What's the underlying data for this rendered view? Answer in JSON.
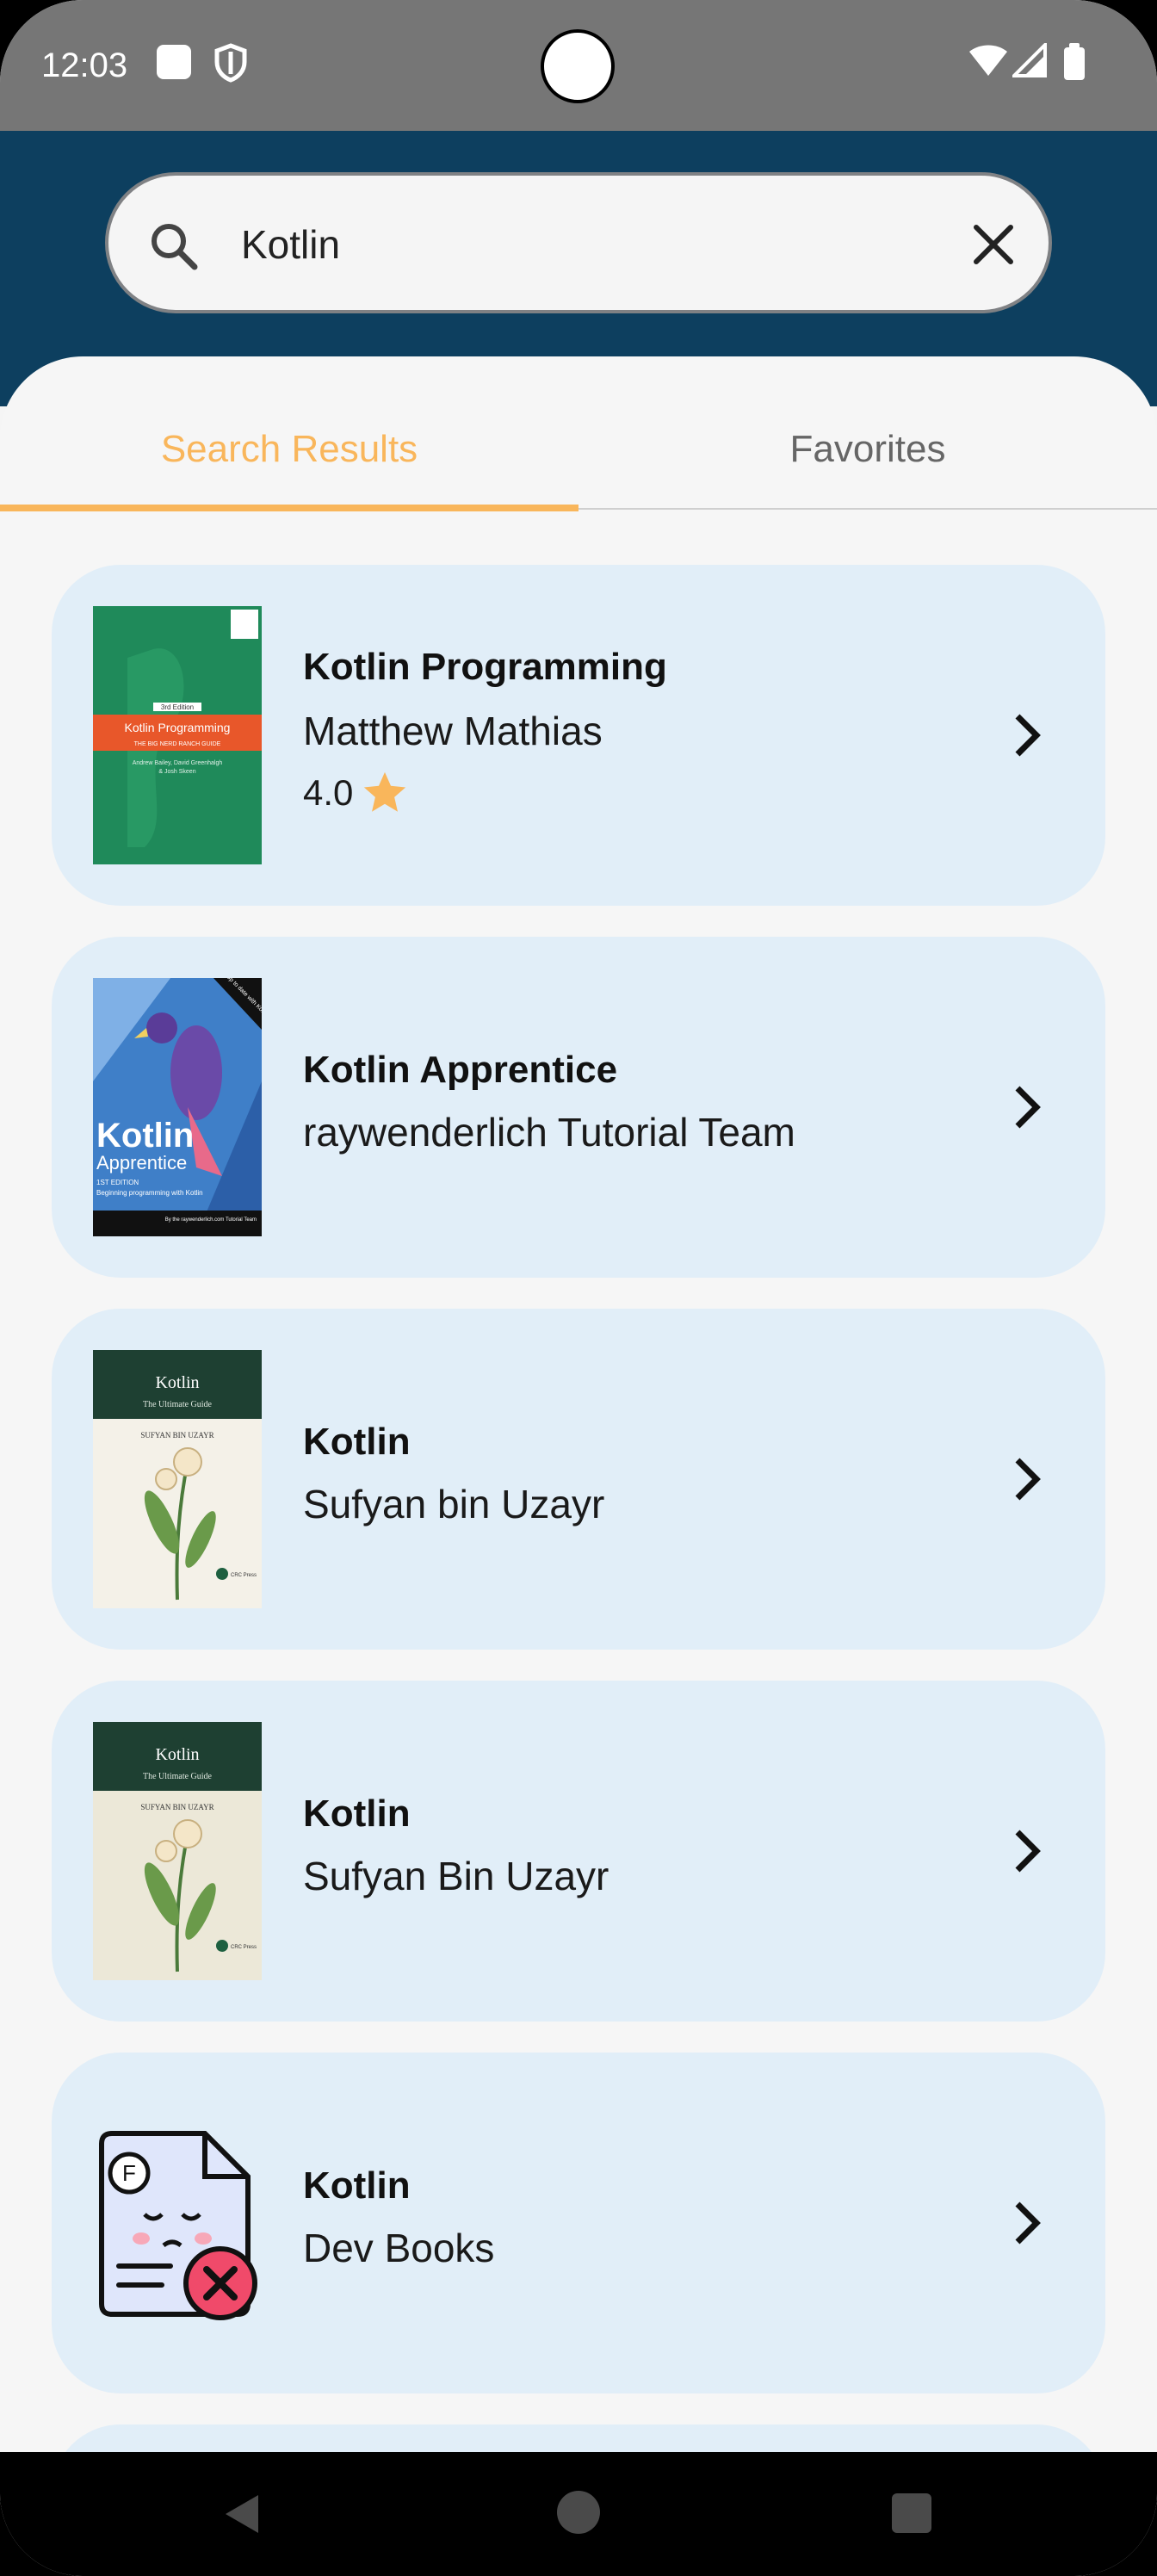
{
  "status_bar": {
    "time": "12:03",
    "left_icons": [
      "notification-square-icon",
      "shield-icon"
    ],
    "right_icons": [
      "wifi-icon",
      "signal-icon",
      "battery-icon"
    ]
  },
  "search": {
    "value": "Kotlin",
    "icon": "search-icon",
    "clear_icon": "close-icon"
  },
  "tabs": [
    {
      "label": "Search Results",
      "active": true
    },
    {
      "label": "Favorites",
      "active": false
    }
  ],
  "colors": {
    "header": "#0d3f5f",
    "accent": "#f9b65b",
    "card": "#e1eef8"
  },
  "books": [
    {
      "title": "Kotlin Programming",
      "author": "Matthew Mathias",
      "rating": "4.0",
      "cover": "kotlin-programming-cover"
    },
    {
      "title": "Kotlin Apprentice",
      "author": "raywenderlich Tutorial Team",
      "cover": "kotlin-apprentice-cover"
    },
    {
      "title": "Kotlin",
      "author": "Sufyan bin Uzayr",
      "cover": "kotlin-ultimate-guide-cover"
    },
    {
      "title": "Kotlin",
      "author": "Sufyan Bin Uzayr",
      "cover": "kotlin-ultimate-guide-cover"
    },
    {
      "title": "Kotlin",
      "author": "Dev Books",
      "cover": "missing-file-placeholder-icon"
    }
  ],
  "cover_text": {
    "book1": {
      "edition": "3rd Edition",
      "title": "Kotlin Programming",
      "subtitle": "THE BIG NERD RANCH GUIDE",
      "authors_line1": "Andrew Bailey, David Greenhalgh",
      "authors_line2": "& Josh Skeen"
    },
    "book2": {
      "title": "Kotlin",
      "subtitle": "Apprentice",
      "edition": "1ST EDITION",
      "tagline": "Beginning programming with Kotlin",
      "byline": "By the raywenderlich.com Tutorial Team",
      "badge": "Up to date with Kotlin"
    },
    "book3": {
      "title": "Kotlin",
      "subtitle": "The Ultimate Guide",
      "author": "SUFYAN BIN UZAYR",
      "publisher": "CRC Press"
    },
    "book4": {
      "title": "Kotlin",
      "subtitle": "The Ultimate Guide",
      "author": "SUFYAN BIN UZAYR",
      "publisher": "CRC Press"
    }
  },
  "nav": [
    "back-icon",
    "home-icon",
    "recents-icon"
  ]
}
